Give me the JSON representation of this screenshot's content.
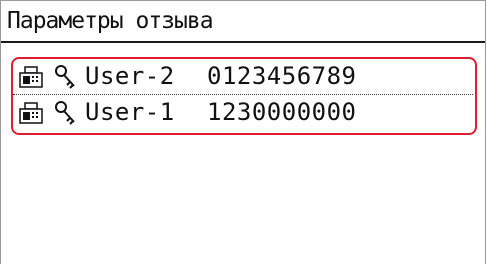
{
  "screen": {
    "title": "Параметры отзыва"
  },
  "entries": [
    {
      "name": "User-2",
      "number": "0123456789",
      "type_icon": "fax-icon",
      "lock_icon": "key-icon"
    },
    {
      "name": "User-1",
      "number": "1230000000",
      "type_icon": "fax-icon",
      "lock_icon": "key-icon"
    }
  ],
  "colors": {
    "highlight": "#e01e2f",
    "text": "#111111",
    "background": "#ffffff"
  }
}
